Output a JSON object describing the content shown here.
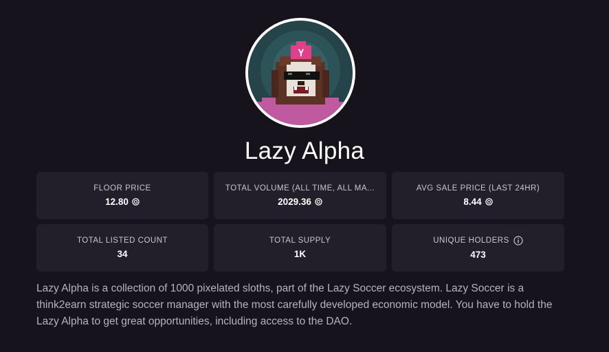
{
  "collection": {
    "name": "Lazy Alpha",
    "description": "Lazy Alpha is a collection of 1000 pixelated sloths, part of the Lazy Soccer ecosystem. Lazy Soccer is a think2earn strategic soccer manager with the most carefully developed economic model. You have to hold the Lazy Alpha to get great opportunities, including access to the DAO."
  },
  "stats": {
    "floor_price": {
      "label": "FLOOR PRICE",
      "value": "12.80",
      "icon": "token-icon"
    },
    "total_volume": {
      "label": "TOTAL VOLUME (ALL TIME, ALL MA...",
      "value": "2029.36",
      "icon": "token-icon"
    },
    "avg_sale_price": {
      "label": "AVG SALE PRICE (LAST 24HR)",
      "value": "8.44",
      "icon": "token-icon"
    },
    "total_listed": {
      "label": "TOTAL LISTED COUNT",
      "value": "34"
    },
    "total_supply": {
      "label": "TOTAL SUPPLY",
      "value": "1K"
    },
    "unique_holders": {
      "label": "UNIQUE HOLDERS",
      "value": "473",
      "icon": "info-icon"
    }
  },
  "avatar": {
    "icon": "sloth-avatar",
    "letter": "Y"
  },
  "colors": {
    "background": "#16131c",
    "card": "#221f2b",
    "avatar_bg": "#2e5a5a",
    "shirt": "#c05aa0",
    "hat": "#e0408a"
  }
}
